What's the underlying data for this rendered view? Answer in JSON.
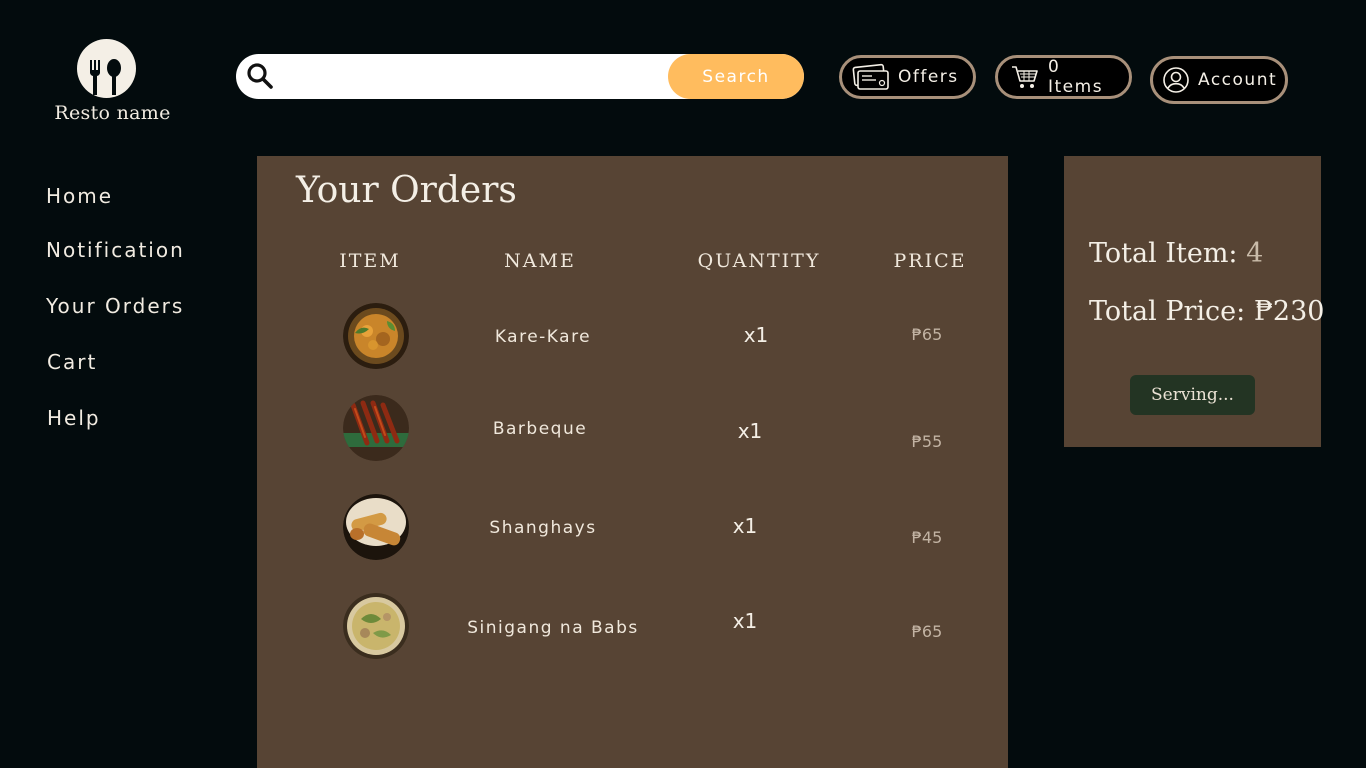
{
  "brand": {
    "name": "Resto name"
  },
  "search": {
    "placeholder": "",
    "value": "",
    "button_label": "Search"
  },
  "header": {
    "offers_label": "Offers",
    "cart_label": "0 Items",
    "account_label": "Account"
  },
  "sidebar": {
    "items": [
      {
        "label": "Home"
      },
      {
        "label": "Notification"
      },
      {
        "label": "Your Orders"
      },
      {
        "label": "Cart"
      },
      {
        "label": "Help"
      }
    ]
  },
  "orders": {
    "title": "Your Orders",
    "columns": {
      "item": "ITEM",
      "name": "NAME",
      "quantity": "QUANTITY",
      "price": "PRICE"
    },
    "rows": [
      {
        "name": "Kare-Kare",
        "quantity": "x1",
        "price": "₱65",
        "image": "kare-kare-dish"
      },
      {
        "name": "Barbeque",
        "quantity": "x1",
        "price": "₱55",
        "image": "barbeque-skewers"
      },
      {
        "name": "Shanghays",
        "quantity": "x1",
        "price": "₱45",
        "image": "lumpia-shanghai"
      },
      {
        "name": "Sinigang na Babs",
        "quantity": "x1",
        "price": "₱65",
        "image": "sinigang-soup"
      }
    ]
  },
  "summary": {
    "total_items_label": "Total Item:",
    "total_items_value": "4",
    "total_price_label": "Total Price:",
    "total_price_value": "₱230",
    "status": "Serving..."
  },
  "colors": {
    "background": "#030b0d",
    "panel": "#574434",
    "accent": "#ffbc5e",
    "pill_border": "#a8907a",
    "status_bg": "#233423"
  },
  "icons": [
    "fork-spoon-icon",
    "search-icon",
    "ticket-icon",
    "cart-icon",
    "user-icon"
  ]
}
